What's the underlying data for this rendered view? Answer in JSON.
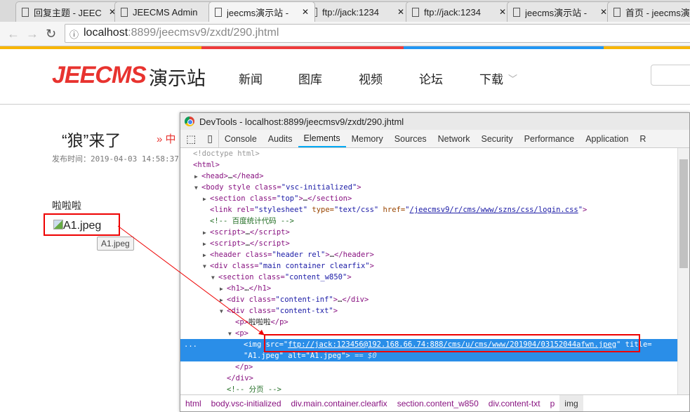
{
  "browser": {
    "tabs": [
      {
        "label": "回复主题 - JEEC"
      },
      {
        "label": "JEECMS Admin"
      },
      {
        "label": "jeecms演示站 -"
      },
      {
        "label": "ftp://jack:1234"
      },
      {
        "label": "ftp://jack:1234"
      },
      {
        "label": "jeecms演示站 -"
      },
      {
        "label": "首页 - jeecms演"
      }
    ],
    "url_host": "localhost",
    "url_rest": ":8899/jeecmsv9/zxdt/290.jhtml"
  },
  "site": {
    "logo": "JEECMS",
    "logo_suffix": "演示站",
    "nav": [
      {
        "label": "新闻"
      },
      {
        "label": "图库"
      },
      {
        "label": "视频"
      },
      {
        "label": "论坛"
      },
      {
        "label": "下载"
      }
    ],
    "article_title": "“狼”来了",
    "breadcrumb": "» 中",
    "publish_time": "发布时间：2019-04-03 14:58:37",
    "paragraph": "啦啦啦",
    "image_alt": "A1.jpeg",
    "tooltip": "A1.jpeg"
  },
  "devtools": {
    "title": "DevTools - localhost:8899/jeecmsv9/zxdt/290.jhtml",
    "tabs": [
      {
        "label": "Console"
      },
      {
        "label": "Audits"
      },
      {
        "label": "Elements"
      },
      {
        "label": "Memory"
      },
      {
        "label": "Sources"
      },
      {
        "label": "Network"
      },
      {
        "label": "Security"
      },
      {
        "label": "Performance"
      },
      {
        "label": "Application"
      },
      {
        "label": "R"
      }
    ],
    "active_tab": "Elements",
    "code": {
      "doctype": "<!doctype html>",
      "html": "<html>",
      "head_open": "<head>",
      "head_close": "</head>",
      "body_tag": "<body style class=",
      "body_class": "\"vsc-initialized\"",
      "section_top": "<section class=",
      "section_top_val": "\"top\"",
      "section_close": "</section>",
      "link_rel": "<link rel=",
      "link_rel_val": "\"stylesheet\"",
      "link_type": " type=",
      "link_type_val": "\"text/css\"",
      "link_href": " href=",
      "link_href_val": "/jeecmsv9/r/cms/www/szns/css/login.css",
      "comment1": "<!-- 百度统计代码 -->",
      "script": "<script>",
      "script_close": "</script>",
      "header": "<header class=",
      "header_val": "\"header rel\"",
      "header_close": "</header>",
      "div_main": "<div class=",
      "div_main_val": "\"main container clearfix\"",
      "section_w": "<section class=",
      "section_w_val": "\"content_w850\"",
      "h1": "<h1>",
      "h1_close": "</h1>",
      "div_inf": "<div class=",
      "div_inf_val": "\"content-inf\"",
      "div_close": "</div>",
      "div_txt": "<div class=",
      "div_txt_val": "\"content-txt\"",
      "p_open": "<p>",
      "p_text": "啦啦啦",
      "p_close": "</p>",
      "img_open": "<img ",
      "img_src": "src=",
      "img_src_val": "ftp://jack:123456@192.168.66.74:888/cms/u/cms/www/201904/03152044afwn.jpeg",
      "img_title": " title=",
      "img_title_val": "\"A1.jpeg\"",
      "img_alt": " alt=",
      "img_alt_val": "\"A1.jpeg\"",
      "img_end": ">",
      "img_eq": " == $0",
      "comment2": "<!-- 分页 -->",
      "ellipsis": "…",
      "dots": "..."
    },
    "breadcrumbs": [
      {
        "label": "html"
      },
      {
        "label": "body.vsc-initialized"
      },
      {
        "label": "div.main.container.clearfix"
      },
      {
        "label": "section.content_w850"
      },
      {
        "label": "div.content-txt"
      },
      {
        "label": "p"
      },
      {
        "label": "img"
      }
    ]
  },
  "colors": {
    "brand": "#e8332f",
    "selection": "#2a8ee8",
    "annotation": "#ee0000"
  }
}
